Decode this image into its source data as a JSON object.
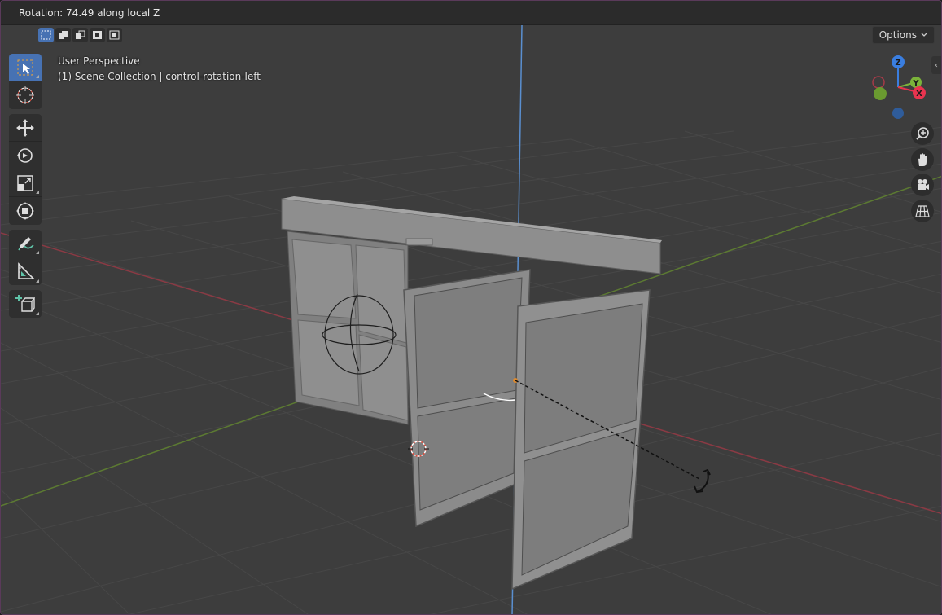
{
  "header": {
    "status_text": "Rotation: 74.49 along local Z"
  },
  "viewport": {
    "view_name": "User Perspective",
    "collection_info": "(1) Scene Collection | control-rotation-left",
    "options_label": "Options"
  },
  "select_modes": [
    {
      "icon": "select-new-icon",
      "active": true
    },
    {
      "icon": "select-extend-icon",
      "active": false
    },
    {
      "icon": "select-subtract-icon",
      "active": false
    },
    {
      "icon": "select-invert-icon",
      "active": false
    },
    {
      "icon": "select-intersect-icon",
      "active": false
    }
  ],
  "tools": [
    {
      "icon": "select-box-icon",
      "active": true
    },
    {
      "icon": "cursor-icon",
      "active": false
    },
    {
      "icon": "move-icon",
      "active": false
    },
    {
      "icon": "rotate-icon",
      "active": false
    },
    {
      "icon": "scale-icon",
      "active": false
    },
    {
      "icon": "transform-icon",
      "active": false
    },
    {
      "icon": "annotate-icon",
      "active": false
    },
    {
      "icon": "measure-icon",
      "active": false
    },
    {
      "icon": "add-cube-icon",
      "active": false
    }
  ],
  "gizmo": {
    "axes": [
      "X",
      "Y",
      "Z"
    ],
    "colors": {
      "x": "#e8344f",
      "y": "#7bb33a",
      "z": "#3a7ee0"
    }
  },
  "nav_buttons": [
    "zoom-icon",
    "pan-hand-icon",
    "camera-icon",
    "grid-view-icon"
  ]
}
